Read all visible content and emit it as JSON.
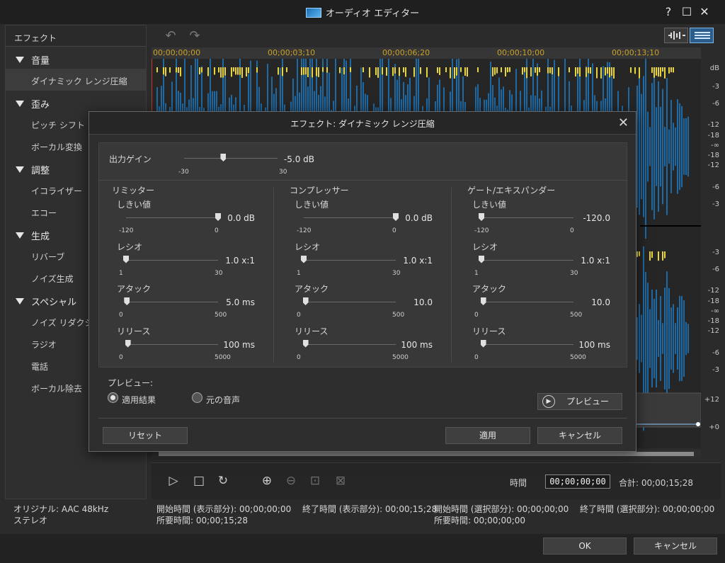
{
  "window": {
    "title": "オーディオ エディター"
  },
  "titlebar_buttons": {
    "help": "?",
    "maximize": "☐",
    "close": "✕"
  },
  "sidebar": {
    "header": "エフェクト",
    "groups": [
      {
        "label": "音量",
        "items": [
          "ダイナミック レンジ圧縮"
        ]
      },
      {
        "label": "歪み",
        "items": [
          "ピッチ シフト",
          "ボーカル変換"
        ]
      },
      {
        "label": "調整",
        "items": [
          "イコライザー",
          "エコー"
        ]
      },
      {
        "label": "生成",
        "items": [
          "リバーブ",
          "ノイズ生成"
        ]
      },
      {
        "label": "スペシャル",
        "items": [
          "ノイズ リダクション",
          "ラジオ",
          "電話",
          "ボーカル除去"
        ]
      }
    ]
  },
  "ruler": {
    "marks": [
      "00;00;00;00",
      "00;00;03;10",
      "00;00;06;20",
      "00;00;10;00",
      "00;00;13;10"
    ]
  },
  "db_scale": {
    "labels": [
      "dB",
      "-3",
      "-6",
      "-12",
      "-18",
      "-∞",
      "-18",
      "-12",
      "-6",
      "-3",
      "-3",
      "-6",
      "-12",
      "-18",
      "-∞",
      "-18",
      "-12",
      "-6",
      "-3",
      "+12",
      "+0"
    ]
  },
  "playbar": {
    "time_label": "時間",
    "time_value": "00;00;00;00",
    "total_label": "合計: 00;00;15;28"
  },
  "status": {
    "original": "オリジナル: AAC 48kHz",
    "channels": "ステレオ",
    "start_display": "開始時間 (表示部分): 00;00;00;00",
    "end_display": "終了時間 (表示部分): 00;00;15;28",
    "start_selection": "開始時間 (選択部分): 00;00;00;00",
    "end_selection": "終了時間 (選択部分): 00;00;00;00",
    "duration": "所要時間: 00;00;15;28",
    "duration_selection": "所要時間: 00;00;00;00"
  },
  "footer": {
    "ok": "OK",
    "cancel": "キャンセル"
  },
  "dialog": {
    "title": "エフェクト: ダイナミック レンジ圧縮",
    "output_gain": {
      "label": "出力ゲイン",
      "value": "-5.0 dB",
      "min": "-30",
      "max": "30",
      "level": 0.42
    },
    "sections": [
      {
        "name": "リミッター",
        "params": [
          {
            "label": "しきい値",
            "value": "0.0 dB",
            "min": "-120",
            "max": "0",
            "level": 1.0
          },
          {
            "label": "レシオ",
            "value": "1.0 x:1",
            "min": "1",
            "max": "30",
            "level": 0.0
          },
          {
            "label": "アタック",
            "value": "5.0 ms",
            "min": "0",
            "max": "500",
            "level": 0.01
          },
          {
            "label": "リリース",
            "value": "100 ms",
            "min": "0",
            "max": "5000",
            "level": 0.02
          }
        ]
      },
      {
        "name": "コンプレッサー",
        "params": [
          {
            "label": "しきい値",
            "value": "0.0 dB",
            "min": "-120",
            "max": "0",
            "level": 1.0
          },
          {
            "label": "レシオ",
            "value": "1.0 x:1",
            "min": "1",
            "max": "30",
            "level": 0.0
          },
          {
            "label": "アタック",
            "value": "10.0",
            "min": "0",
            "max": "500",
            "level": 0.02
          },
          {
            "label": "リリース",
            "value": "100 ms",
            "min": "0",
            "max": "5000",
            "level": 0.02
          }
        ]
      },
      {
        "name": "ゲート/エキスパンダー",
        "params": [
          {
            "label": "しきい値",
            "value": "-120.0",
            "min": "-120",
            "max": "0",
            "level": 0.0
          },
          {
            "label": "レシオ",
            "value": "1.0 x:1",
            "min": "1",
            "max": "30",
            "level": 0.0
          },
          {
            "label": "アタック",
            "value": "10.0",
            "min": "0",
            "max": "500",
            "level": 0.02
          },
          {
            "label": "リリース",
            "value": "100 ms",
            "min": "0",
            "max": "5000",
            "level": 0.02
          }
        ]
      }
    ],
    "preview_label": "プレビュー:",
    "radio_applied": "適用結果",
    "radio_original": "元の音声",
    "preview_button": "プレビュー",
    "reset": "リセット",
    "apply": "適用",
    "cancel": "キャンセル"
  },
  "colors": {
    "wave_blue": "#1f6aa5",
    "wave_yellow": "#e8d43c",
    "ruler_text": "#c9a227"
  }
}
